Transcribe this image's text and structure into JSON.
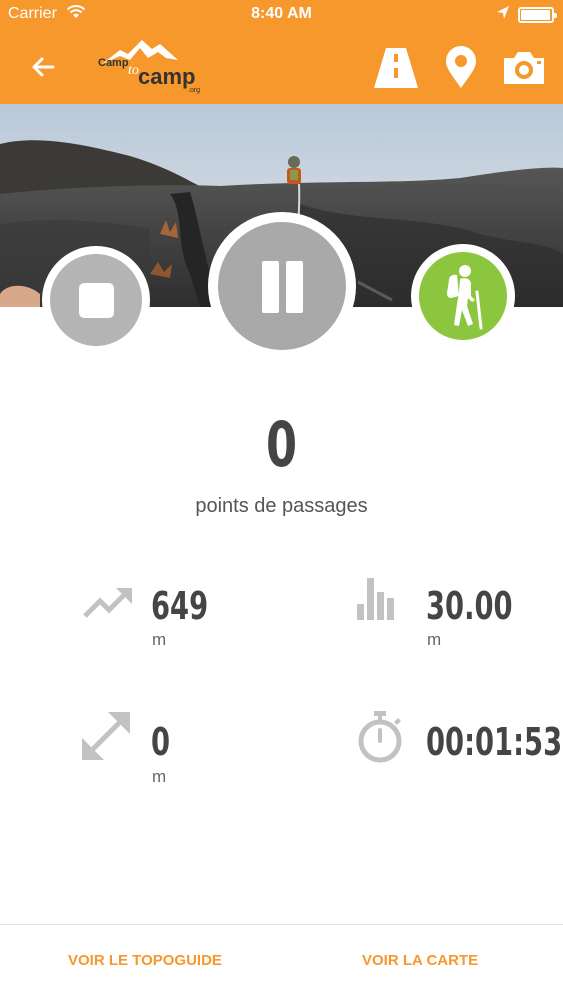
{
  "status_bar": {
    "carrier": "Carrier",
    "time": "8:40 AM",
    "battery_level": 0.95
  },
  "nav": {
    "back_icon": "arrow-left-icon",
    "logo": {
      "text_top": "Camp",
      "text_to": "to",
      "text_bottom": "camp",
      "text_tld": ".org"
    },
    "actions": [
      "road-icon",
      "map-pin-icon",
      "camera-icon"
    ]
  },
  "controls": {
    "stop": "stop-icon",
    "pause": "pause-icon",
    "activity": "hiker-icon"
  },
  "waypoints": {
    "value": "0",
    "label": "points de passages"
  },
  "stats": {
    "elevation_gain": {
      "icon": "trending-up-icon",
      "value": "649",
      "unit": "m"
    },
    "altitude": {
      "icon": "bar-chart-icon",
      "value": "30.00",
      "unit": "m"
    },
    "distance": {
      "icon": "diagonal-arrows-icon",
      "value": "0",
      "unit": "m"
    },
    "duration": {
      "icon": "stopwatch-icon",
      "value": "00:01:53"
    }
  },
  "bottom_bar": {
    "topoguide_label": "VOIR LE TOPOGUIDE",
    "map_label": "VOIR LA CARTE"
  },
  "colors": {
    "brand_orange": "#f7982c",
    "activity_green": "#8cc63f",
    "control_gray": "#a9a9a9"
  }
}
